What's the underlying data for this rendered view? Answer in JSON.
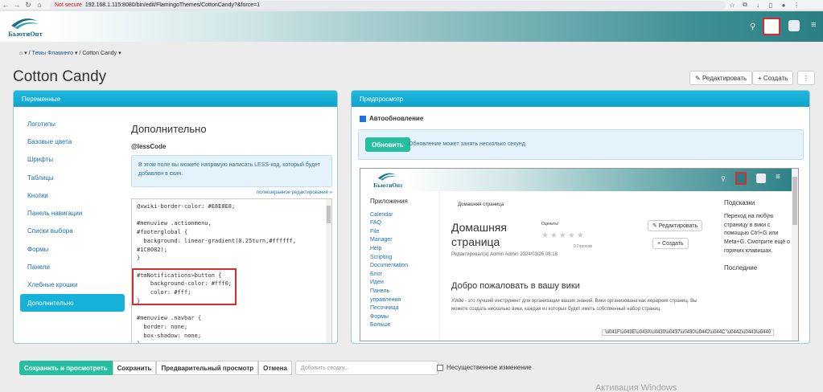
{
  "browser": {
    "not_secure": "Not secure",
    "url": "192.168.1.115:8080/bin/edit/FlamingoThemes/CottonCandy?&force=1"
  },
  "header": {
    "brand": "БьютиОпт"
  },
  "breadcrumb": {
    "item1": "Темы Фламинго",
    "item2": "Cotton Candy"
  },
  "page": {
    "title": "Cotton Candy",
    "edit_label": "Редактировать",
    "create_label": "Создать"
  },
  "variables_panel": {
    "title": "Переменные",
    "sidebar": [
      "Логотипы",
      "Базовые цвета",
      "Шрифты",
      "Таблицы",
      "Кнопки",
      "Панель навигации",
      "Списки выбора",
      "Формы",
      "Панели",
      "Хлебные крошки",
      "Дополнительно"
    ],
    "heading": "Дополнительно",
    "subheading": "@lessCode",
    "info": "В этом поле вы можете напрямую написать LESS-код, который будет добавлен в скин.",
    "fullscreen_link": "полноэкранное редактирование »",
    "code": "@xwiki-border-color: #E8E8E8;\n\n#menuview .actionmenu,\n#footerglobal {\n  background: linear-gradient(0.25turn,#ffffff,\n#1C8082);\n}\n\n#tmNotifications>button {\n    background-color: #fff0;\n    color: #fff;\n}\n\n#menuview .navbar {\n  border: none;\n  box-shadow: none;\n}"
  },
  "preview_panel": {
    "title": "Предпросмотр",
    "auto_label": "Автообновление",
    "update_button": "Обновить",
    "update_note": "Обновление может занять несколько секунд.",
    "frame": {
      "brand": "БьютиОпт",
      "apps_title": "Приложения",
      "apps": [
        "Calendar",
        "FAQ",
        "File",
        "Manager",
        "Help",
        "Scripting",
        "Documentation",
        "Блог",
        "Идеи",
        "Панель",
        "управления",
        "Песочница",
        "Формы",
        "Больше"
      ],
      "crumb": "Домашняя страница",
      "title": "Домашняя страница",
      "edited_by": "Редактировал(а) Admin Admin 2024/03/26 08:18",
      "rate_label": "Оценить!",
      "votes": "0 Голосов",
      "edit_label": "Редактировать",
      "create_label": "Создать",
      "welcome": "Добро пожаловать в вашу вики",
      "intro": "XWiki - это лучший инструмент для организации ваших знаний. Вики организована как иерархия страниц. Вы можете создать несколько вики, каждая из которых будет иметь собственный набор страниц.",
      "tips_title": "Подсказки",
      "tips_body": "Переход на любую страницу в вики с помощью Ctrl+G или Meta+G. Смотрите ещё о горячих клавишах.",
      "last_title": "Последние",
      "tooltip": "\\u041F\\u043E\\u043A\\u0430\\u0437\\u0430\\u0442\\u044C \\u0442\\u0443\\u0440"
    }
  },
  "actions": {
    "save_view": "Сохранить и просмотреть",
    "save": "Сохранить",
    "preview": "Предварительный просмотр",
    "cancel": "Отмена",
    "summary_placeholder": "Добавить сводку...",
    "minor_edit": "Несущественное изменение"
  },
  "os": {
    "watermark": "Активация Windows"
  }
}
